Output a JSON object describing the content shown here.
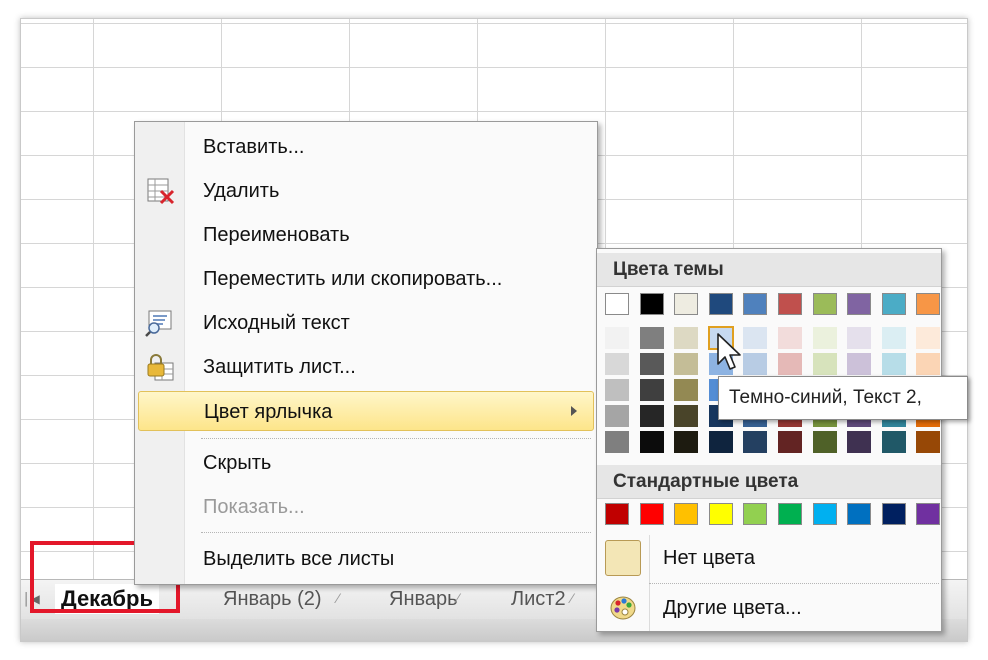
{
  "sheet_tabs": {
    "active": "Декабрь",
    "others": [
      "Январь (2)",
      "Январь",
      "Лист2"
    ]
  },
  "context_menu": {
    "items": [
      {
        "label": "Вставить...",
        "icon": ""
      },
      {
        "label": "Удалить",
        "icon": "delete-sheet-icon"
      },
      {
        "label": "Переименовать",
        "icon": ""
      },
      {
        "label": "Переместить или скопировать...",
        "icon": ""
      },
      {
        "label": "Исходный текст",
        "icon": "view-code-icon"
      },
      {
        "label": "Защитить лист...",
        "icon": "protect-sheet-icon"
      },
      {
        "label": "Цвет ярлычка",
        "icon": "",
        "selected": true,
        "has_submenu": true
      },
      {
        "label": "Скрыть",
        "icon": ""
      },
      {
        "label": "Показать...",
        "icon": "",
        "disabled": true
      },
      {
        "label": "Выделить все листы",
        "icon": ""
      }
    ]
  },
  "color_menu": {
    "theme_header": "Цвета темы",
    "standard_header": "Стандартные цвета",
    "no_color_label": "Нет цвета",
    "more_colors_label": "Другие цвета...",
    "theme_colors": [
      "#ffffff",
      "#000000",
      "#eeece1",
      "#1f497d",
      "#4f81bd",
      "#c0504d",
      "#9bbb59",
      "#8064a2",
      "#4bacc6",
      "#f79646"
    ],
    "theme_shades": [
      [
        "#f2f2f2",
        "#d8d8d8",
        "#bfbfbf",
        "#a5a5a5",
        "#7f7f7f"
      ],
      [
        "#7f7f7f",
        "#595959",
        "#3f3f3f",
        "#262626",
        "#0c0c0c"
      ],
      [
        "#ddd9c3",
        "#c4bd97",
        "#938953",
        "#494429",
        "#1d1b10"
      ],
      [
        "#c6d9f0",
        "#8db3e2",
        "#548dd4",
        "#17365d",
        "#0f243e"
      ],
      [
        "#dbe5f1",
        "#b8cce4",
        "#95b3d7",
        "#366092",
        "#244061"
      ],
      [
        "#f2dcdb",
        "#e5b9b7",
        "#d99694",
        "#953734",
        "#632423"
      ],
      [
        "#ebf1dd",
        "#d7e3bc",
        "#c3d69b",
        "#76923c",
        "#4f6128"
      ],
      [
        "#e5e0ec",
        "#ccc1d9",
        "#b2a2c7",
        "#5f497a",
        "#3f3151"
      ],
      [
        "#dbeef3",
        "#b7dde8",
        "#92cddc",
        "#31859b",
        "#205867"
      ],
      [
        "#fdeada",
        "#fbd5b5",
        "#fac08f",
        "#e36c09",
        "#974806"
      ]
    ],
    "standard_colors": [
      "#c00000",
      "#ff0000",
      "#ffc000",
      "#ffff00",
      "#92d050",
      "#00b050",
      "#00b0f0",
      "#0070c0",
      "#002060",
      "#7030a0"
    ],
    "no_color_swatch": "#f3e6b6"
  },
  "tooltip": {
    "text": "Темно-синий, Текст 2,"
  },
  "colors": {
    "highlight_border": "#e3172a",
    "menu_selection": "#fde58a"
  }
}
